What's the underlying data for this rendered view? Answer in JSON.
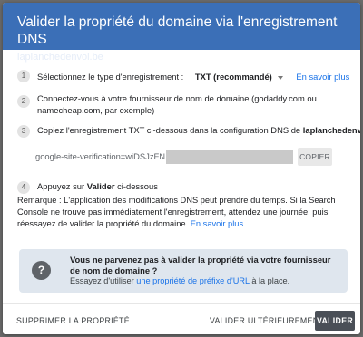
{
  "header": {
    "title": "Valider la propriété du domaine via l'enregistrement DNS",
    "domain": "laplanchedenvol.be"
  },
  "steps": [
    {
      "number": "1",
      "label": "Sélectionnez le type d'enregistrement :",
      "record_type": "TXT (recommandé)",
      "learn_more": "En savoir plus"
    },
    {
      "number": "2",
      "line1": "Connectez-vous à votre fournisseur de nom de domaine (godaddy.com ou",
      "line2": "namecheap.com, par exemple)"
    },
    {
      "number": "3",
      "text_prefix": "Copiez l'enregistrement TXT ci-dessous dans la configuration DNS de",
      "domain": "laplanchedenvol.be"
    },
    {
      "number": "4",
      "text_prefix": "Appuyez sur",
      "action": "Valider",
      "text_suffix": "ci-dessous"
    }
  ],
  "txt_record": {
    "value": "google-site-verification=wiDSJzFN",
    "copy_label": "COPIER"
  },
  "remark": {
    "text": "Remarque : L'application des modifications DNS peut prendre du temps. Si la Search Console ne trouve pas immédiatement l'enregistrement, attendez une journée, puis réessayez de valider la propriété du domaine.",
    "link": "En savoir plus"
  },
  "notice": {
    "icon": "question-icon",
    "title": "Vous ne parvenez pas à valider la propriété via votre fournisseur de nom de domaine ?",
    "body_prefix": "Essayez d'utiliser",
    "body_link": "une propriété de préfixe d'URL",
    "body_suffix": "à la place."
  },
  "footer": {
    "delete_label": "SUPPRIMER LA PROPRIÉTÉ",
    "later_label": "VALIDER ULTÉRIEUREMENT",
    "validate_label": "VALIDER"
  },
  "colors": {
    "header_bg": "#3b6fb7",
    "link": "#1a73e8",
    "notice_bg": "#dfe6ee",
    "primary_button": "#4a4f57"
  }
}
